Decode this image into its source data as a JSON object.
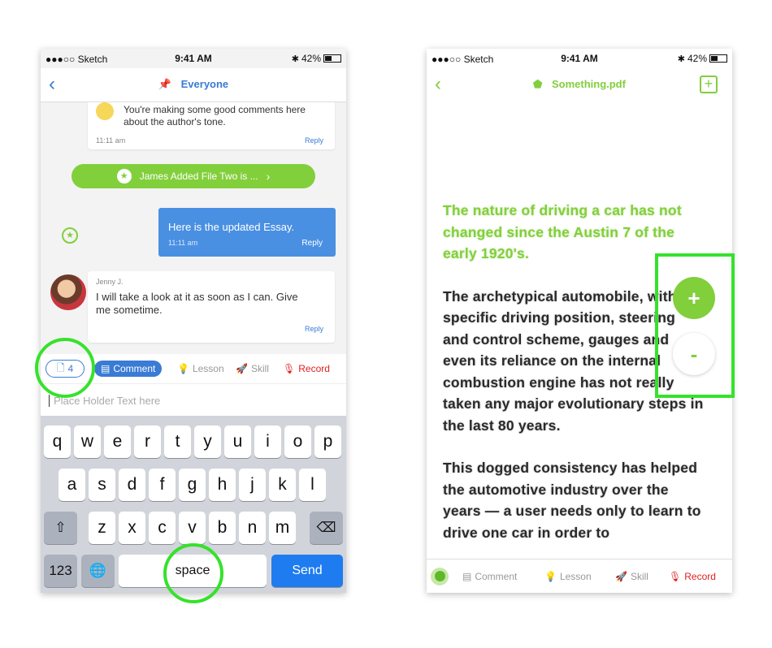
{
  "status_bar": {
    "carrier": "●●●○○ Sketch",
    "time": "9:41 AM",
    "battery": "42%"
  },
  "left": {
    "nav_title": "Everyone",
    "messages": {
      "first_text": "You're making some good comments here about the author's tone.",
      "first_time": "11:11 am",
      "first_reply": "Reply",
      "file_banner": "James Added File Two is ...",
      "outgoing_text": "Here is the updated Essay.",
      "outgoing_time": "11:11 am",
      "outgoing_reply": "Reply",
      "incoming_name": "Jenny J.",
      "incoming_text": "I will take a look at it as soon as I can. Give me sometime.",
      "incoming_reply": "Reply"
    },
    "toolbar": {
      "file_count": "4",
      "comment": "Comment",
      "lesson": "Lesson",
      "skill": "Skill",
      "record": "Record"
    },
    "input_placeholder": "Place Holder Text here",
    "keyboard": {
      "row1": [
        "q",
        "w",
        "e",
        "r",
        "t",
        "y",
        "u",
        "i",
        "o",
        "p"
      ],
      "row2": [
        "a",
        "s",
        "d",
        "f",
        "g",
        "h",
        "j",
        "k",
        "l"
      ],
      "row3": [
        "z",
        "x",
        "c",
        "v",
        "b",
        "n",
        "m"
      ],
      "numbers": "123",
      "space": "space",
      "send": "Send"
    }
  },
  "right": {
    "nav_title": "Something.pdf",
    "pdf": {
      "title": "The nature of driving a car has not changed since the Austin 7 of the early 1920's.",
      "para1": "The archetypical automobile, with its specific driving position, steering and control scheme, gauges and even its reliance on the internal combustion engine has not really taken any major evolutionary steps in the last 80 years.",
      "para2": "This dogged consistency has helped the automotive industry over the years — a user needs only to learn to drive one car in order to"
    },
    "zoom_in": "+",
    "zoom_out": "-",
    "toolbar": {
      "comment": "Comment",
      "lesson": "Lesson",
      "skill": "Skill",
      "record": "Record"
    }
  },
  "colors": {
    "blue": "#3a7bd5",
    "green": "#82cf3c",
    "highlight": "#35e22b",
    "record_red": "#e02020"
  }
}
